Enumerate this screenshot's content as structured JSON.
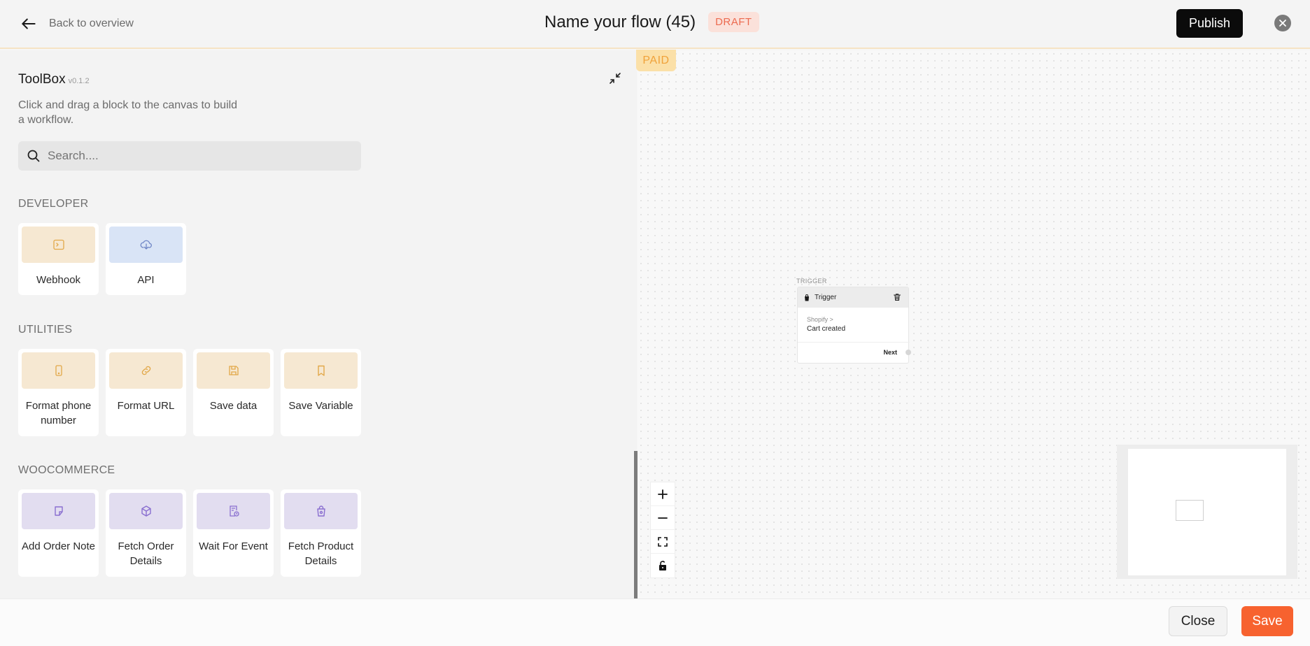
{
  "header": {
    "back_label": "Back to overview",
    "title": "Name your flow (45)",
    "status_badge": "DRAFT",
    "publish_label": "Publish"
  },
  "toolbox": {
    "title": "ToolBox",
    "version": "v0.1.2",
    "description": "Click and drag a block to the canvas to build a workflow.",
    "search_placeholder": "Search....",
    "sections": [
      {
        "label": "DEVELOPER",
        "items": [
          {
            "label": "Webhook",
            "icon": "terminal-icon"
          },
          {
            "label": "API",
            "icon": "cloud-download-icon"
          }
        ]
      },
      {
        "label": "UTILITIES",
        "items": [
          {
            "label": "Format phone number",
            "icon": "phone-icon"
          },
          {
            "label": "Format URL",
            "icon": "link-icon"
          },
          {
            "label": "Save data",
            "icon": "floppy-icon"
          },
          {
            "label": "Save Variable",
            "icon": "bookmark-icon"
          }
        ]
      },
      {
        "label": "WOOCOMMERCE",
        "items": [
          {
            "label": "Add Order Note",
            "icon": "note-icon"
          },
          {
            "label": "Fetch Order Details",
            "icon": "box-icon"
          },
          {
            "label": "Wait For Event",
            "icon": "clock-doc-icon"
          },
          {
            "label": "Fetch Product Details",
            "icon": "bag-icon"
          }
        ]
      }
    ]
  },
  "canvas": {
    "plan_badge": "PAID",
    "node": {
      "caption": "TRIGGER",
      "title": "Trigger",
      "source": "Shopify >",
      "event": "Cart created",
      "output": "Next"
    }
  },
  "footer": {
    "close_label": "Close",
    "save_label": "Save"
  },
  "colors": {
    "accent_save": "#f7622f",
    "draft_badge": "#ec6a4f",
    "paid_badge": "#f0a23a"
  }
}
